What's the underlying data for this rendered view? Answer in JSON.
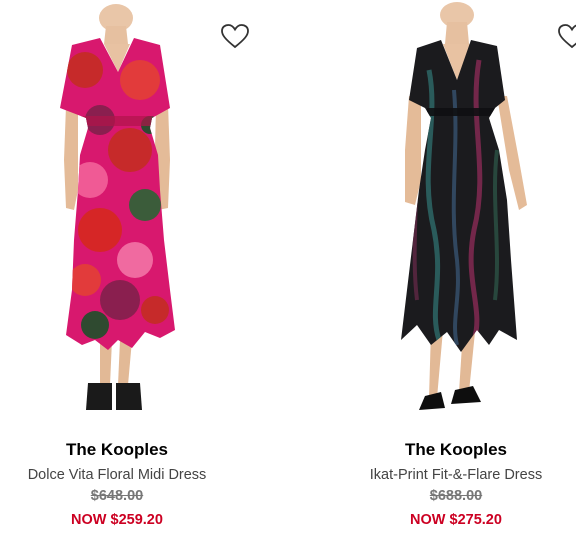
{
  "products": [
    {
      "brand": "The Kooples",
      "name": "Dolce Vita Floral Midi Dress",
      "original_price": "$648.00",
      "sale_price": "NOW $259.20",
      "image_icon": "floral-pink-dress-image",
      "favorite_icon": "heart-outline-icon"
    },
    {
      "brand": "The Kooples",
      "name": "Ikat-Print Fit-&-Flare Dress",
      "original_price": "$688.00",
      "sale_price": "NOW $275.20",
      "image_icon": "dark-ikat-dress-image",
      "favorite_icon": "heart-outline-icon"
    }
  ],
  "colors": {
    "sale": "#cc0022",
    "brand_text": "#000000",
    "name_text": "#444444",
    "strikethrough": "#777777",
    "dress_0_base": "#d8186e",
    "dress_1_base": "#1b1b1e"
  }
}
